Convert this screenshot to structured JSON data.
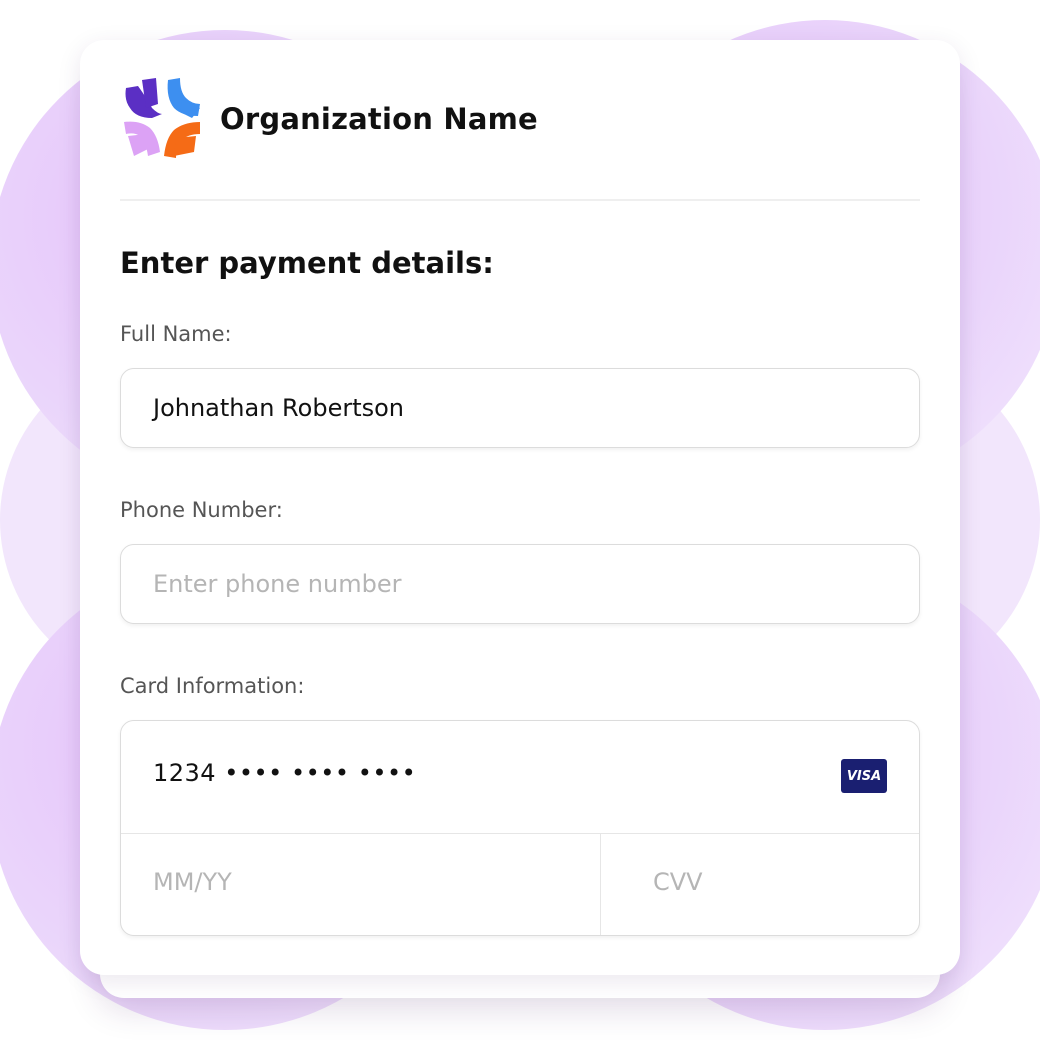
{
  "organization": {
    "name": "Organization Name",
    "logo_colors": [
      "#5b2fc4",
      "#3d8ff0",
      "#dca2f5",
      "#f56b16"
    ]
  },
  "form": {
    "title": "Enter payment details:",
    "full_name": {
      "label": "Full Name:",
      "value": "Johnathan Robertson"
    },
    "phone": {
      "label": "Phone Number:",
      "placeholder": "Enter phone number"
    },
    "card": {
      "label": "Card Information:",
      "number_value": "1234 •••• •••• ••••",
      "brand": "VISA",
      "expiry_placeholder": "MM/YY",
      "cvv_placeholder": "CVV"
    }
  },
  "colors": {
    "background_blob": "#e6c2fb",
    "visa_blue": "#1a1f71"
  }
}
